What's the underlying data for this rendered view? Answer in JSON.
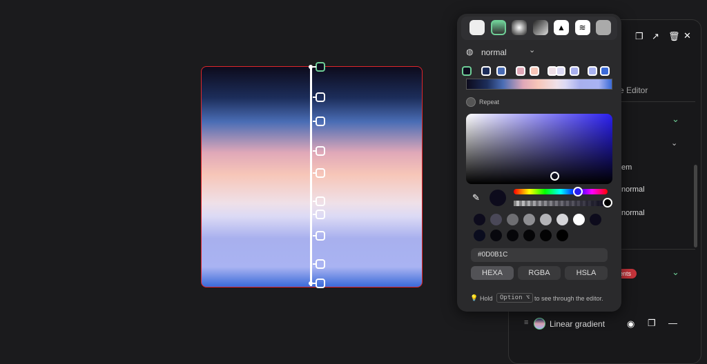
{
  "canvas": {
    "gradient_stops": [
      {
        "color": "#0D0B1C",
        "pos": 0
      },
      {
        "color": "#1C2D5A",
        "pos": 14
      },
      {
        "color": "#4A6DB5",
        "pos": 25
      },
      {
        "color": "#E0A8B8",
        "pos": 39
      },
      {
        "color": "#F7C6B8",
        "pos": 49
      },
      {
        "color": "#EFE0E8",
        "pos": 62
      },
      {
        "color": "#DCDAF5",
        "pos": 68
      },
      {
        "color": "#A8B0EE",
        "pos": 78
      },
      {
        "color": "#A9B3F2",
        "pos": 91
      },
      {
        "color": "#3A6AD8",
        "pos": 100
      }
    ]
  },
  "popup": {
    "fill_types": [
      "solid",
      "linear-gradient",
      "radial-gradient",
      "conic-gradient",
      "image",
      "pattern",
      "noise"
    ],
    "blend_mode": "normal",
    "repeat_label": "Repeat",
    "hex_value": "#0D0B1C",
    "formats": [
      "HEXA",
      "RGBA",
      "HSLA"
    ],
    "hint_hold": "Hold",
    "hint_key": "Option ⌥",
    "hint_rest": "to see through the editor.",
    "swatches_row1": [
      "#0D0B1C",
      "#4A4858",
      "#6E6E72",
      "#8E8E92",
      "#B4B4B8",
      "#D6D6DA",
      "#FFFFFF",
      "#0D0B1C"
    ],
    "swatches_row2": [
      "#0A0C1E",
      "#08080E",
      "#060609",
      "#050507",
      "#030304",
      "#000000"
    ]
  },
  "panel": {
    "editor_label": "e Editor",
    "em_label": "em",
    "normal1": "normal",
    "normal2": "normal",
    "badge": "ients",
    "layer_name": "Linear gradient"
  },
  "accent": "#6FCF97"
}
